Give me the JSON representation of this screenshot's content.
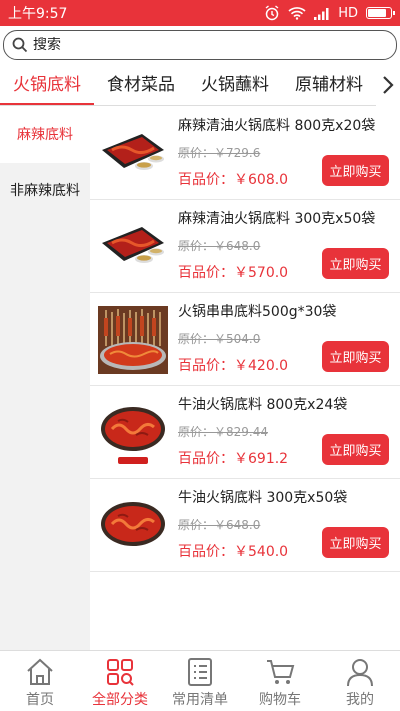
{
  "status_bar": {
    "time": "上午9:57",
    "network": "HD",
    "battery_level": 0.85
  },
  "search": {
    "placeholder": "搜索"
  },
  "tabs": [
    {
      "label": "火锅底料",
      "active": true
    },
    {
      "label": "食材菜品",
      "active": false
    },
    {
      "label": "火锅蘸料",
      "active": false
    },
    {
      "label": "原辅材料",
      "active": false
    }
  ],
  "sidenav": [
    {
      "label": "麻辣底料",
      "active": true
    },
    {
      "label": "非麻辣底料",
      "active": false
    }
  ],
  "products": [
    {
      "name": "麻辣清油火锅底料 800克x20袋",
      "original": "原价：￥729.6",
      "price": "百品价：￥608.0",
      "buy": "立即购买",
      "image": "pot-tray-icon"
    },
    {
      "name": "麻辣清油火锅底料 300克x50袋",
      "original": "原价：￥648.0",
      "price": "百品价：￥570.0",
      "buy": "立即购买",
      "image": "pot-tray-icon"
    },
    {
      "name": "火锅串串底料500g*30袋",
      "original": "原价：￥504.0",
      "price": "百品价：￥420.0",
      "buy": "立即购买",
      "image": "skewer-pot-icon"
    },
    {
      "name": "牛油火锅底料 800克x24袋",
      "original": "原价：￥829.44",
      "price": "百品价：￥691.2",
      "buy": "立即购买",
      "image": "round-pot-icon"
    },
    {
      "name": "牛油火锅底料 300克x50袋",
      "original": "原价：￥648.0",
      "price": "百品价：￥540.0",
      "buy": "立即购买",
      "image": "round-pot-icon"
    }
  ],
  "bottom_nav": [
    {
      "label": "首页",
      "icon": "home-icon",
      "active": false
    },
    {
      "label": "全部分类",
      "icon": "category-icon",
      "active": true
    },
    {
      "label": "常用清单",
      "icon": "list-icon",
      "active": false
    },
    {
      "label": "购物车",
      "icon": "cart-icon",
      "active": false
    },
    {
      "label": "我的",
      "icon": "user-icon",
      "active": false
    }
  ],
  "colors": {
    "accent": "#e8333a",
    "nav_inactive": "#777777",
    "sidebar_bg": "#f2f2f2"
  }
}
